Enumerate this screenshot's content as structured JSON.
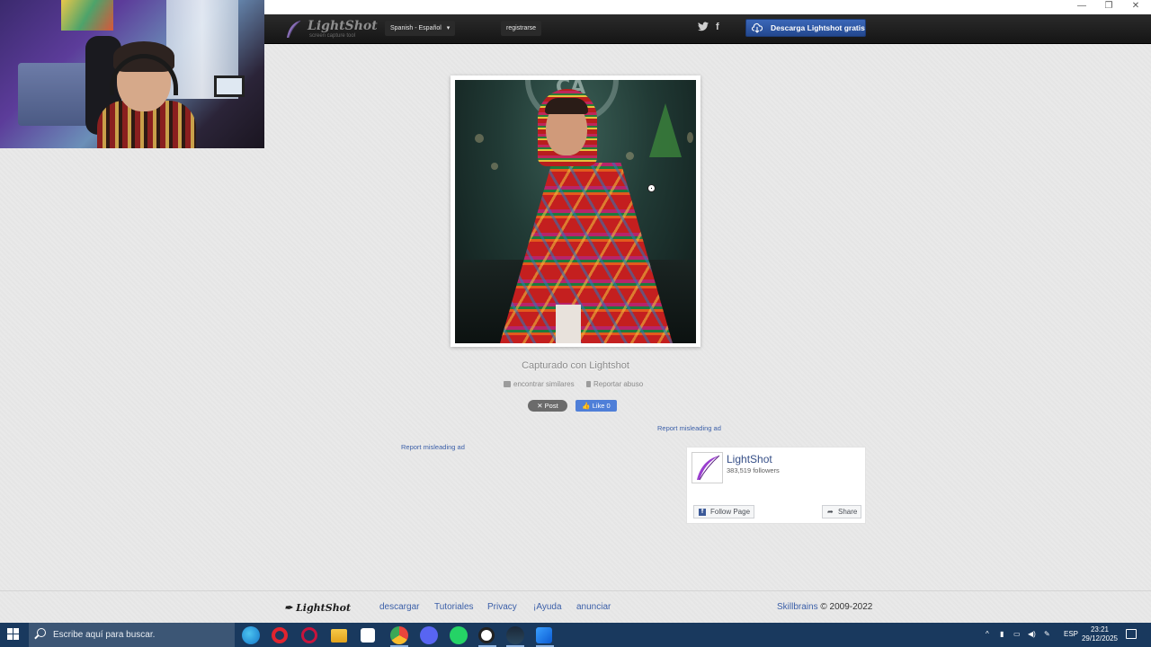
{
  "window": {
    "minimize": "—",
    "restore": "❐",
    "close": "✕"
  },
  "nav": {
    "logo_text": "LightShot",
    "logo_sub": "screen capture tool",
    "language": "Spanish - Español",
    "register": "registrarse",
    "twitter_icon": "twitter-bird",
    "facebook_icon": "f",
    "download": "Descarga Lightshot gratis"
  },
  "screenshot": {
    "caption": "Capturado con Lightshot",
    "find_similar": "encontrar similares",
    "report_abuse": "Reportar abuso",
    "post": "✕ Post",
    "like": "👍 Like 0",
    "report_ad_1": "Report misleading ad",
    "report_ad_2": "Report misleading ad"
  },
  "fb_widget": {
    "name": "LightShot",
    "followers": "383,519 followers",
    "follow": "Follow Page",
    "share": "Share"
  },
  "footer": {
    "logo": "LightShot",
    "links": [
      "descargar",
      "Tutoriales",
      "Privacy",
      "¡Ayuda",
      "anunciar"
    ],
    "brand": "Skillbrains",
    "copyright": " © 2009-2022"
  },
  "taskbar": {
    "search_placeholder": "Escribe aquí para buscar.",
    "language": "ESP",
    "time": "23:21",
    "date": "29/12/2025"
  },
  "colors": {
    "accent": "#2b55a6",
    "nav_bg": "#1c1c1c",
    "page_bg": "#e9e9e9",
    "taskbar": "#19395e",
    "link": "#3b5fa8"
  }
}
